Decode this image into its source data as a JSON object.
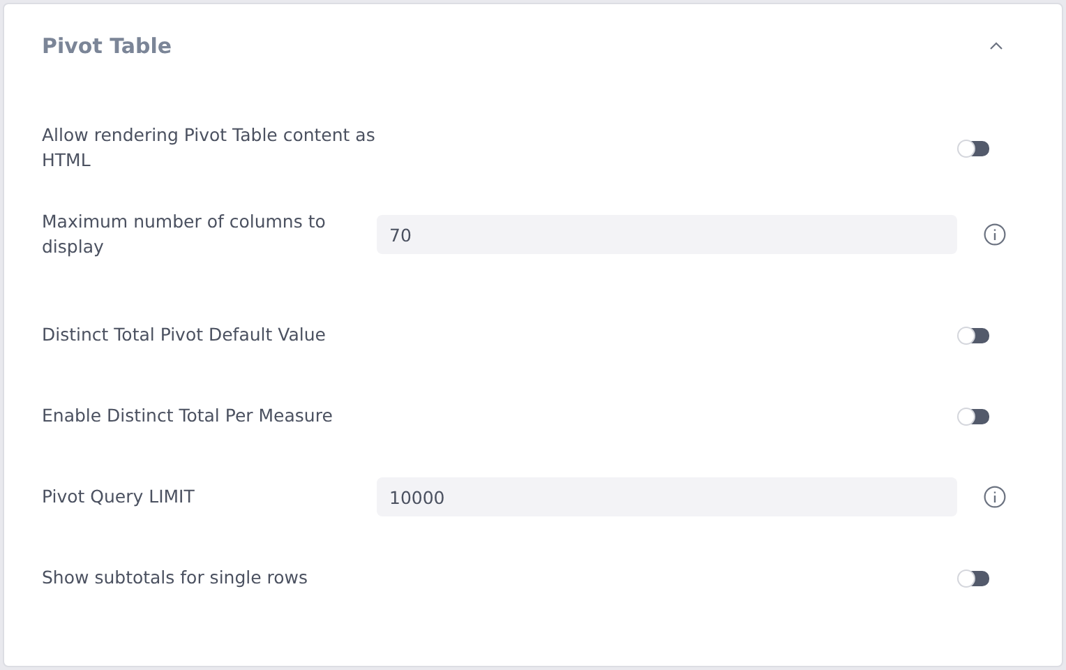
{
  "panel": {
    "title": "Pivot Table",
    "expanded": true
  },
  "settings": [
    {
      "kind": "toggle",
      "label": "Allow rendering Pivot Table content as HTML",
      "on": false
    },
    {
      "kind": "number",
      "label": "Maximum number of columns to display",
      "value": "70"
    },
    {
      "kind": "toggle",
      "label": "Distinct Total Pivot Default Value",
      "on": false
    },
    {
      "kind": "toggle",
      "label": "Enable Distinct Total Per Measure",
      "on": false
    },
    {
      "kind": "number",
      "label": "Pivot Query LIMIT",
      "value": "10000"
    },
    {
      "kind": "toggle",
      "label": "Show subtotals for single rows",
      "on": false
    }
  ]
}
